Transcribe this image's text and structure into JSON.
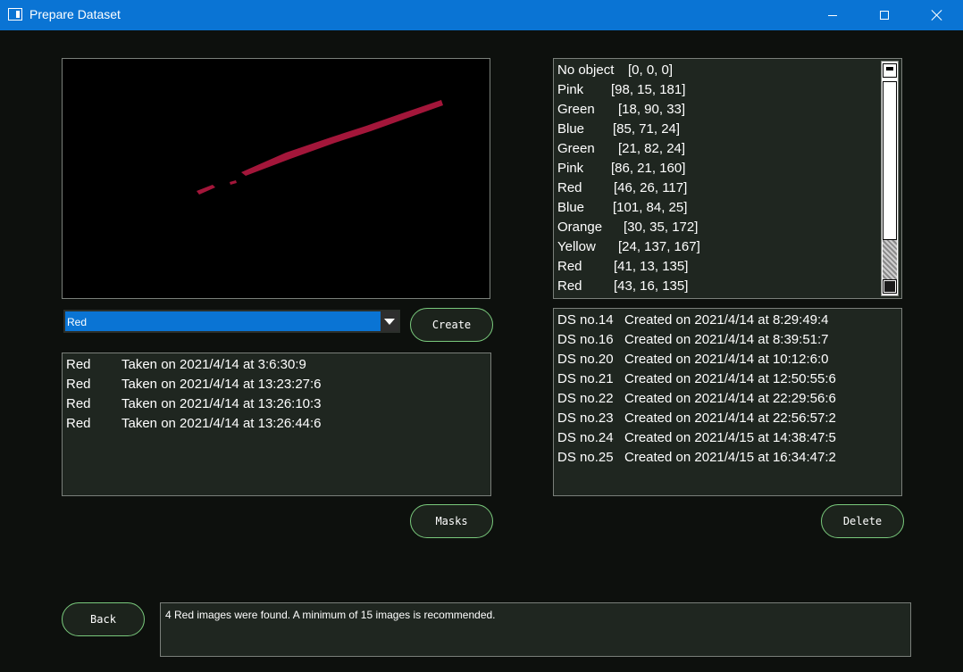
{
  "window": {
    "title": "Prepare Dataset"
  },
  "combo": {
    "selected": "Red"
  },
  "buttons": {
    "create": "Create",
    "masks": "Masks",
    "delete": "Delete",
    "back": "Back"
  },
  "images_list": [
    {
      "color": "Red",
      "info": "Taken on 2021/4/14 at 3:6:30:9"
    },
    {
      "color": "Red",
      "info": "Taken on 2021/4/14 at 13:23:27:6"
    },
    {
      "color": "Red",
      "info": "Taken on 2021/4/14 at 13:26:10:3"
    },
    {
      "color": "Red",
      "info": "Taken on 2021/4/14 at 13:26:44:6"
    }
  ],
  "objects_list": [
    {
      "name": "No object",
      "value": "[0, 0, 0]"
    },
    {
      "name": "Pink",
      "value": "[98, 15, 181]"
    },
    {
      "name": "Green",
      "value": "[18, 90, 33]"
    },
    {
      "name": "Blue",
      "value": "[85, 71, 24]"
    },
    {
      "name": "Green",
      "value": "[21, 82, 24]"
    },
    {
      "name": "Pink",
      "value": "[86, 21, 160]"
    },
    {
      "name": "Red",
      "value": "[46, 26, 117]"
    },
    {
      "name": "Blue",
      "value": "[101, 84, 25]"
    },
    {
      "name": "Orange",
      "value": "[30, 35, 172]"
    },
    {
      "name": "Yellow",
      "value": "[24, 137, 167]"
    },
    {
      "name": "Red",
      "value": "[41, 13, 135]"
    },
    {
      "name": "Red",
      "value": "[43, 16, 135]"
    }
  ],
  "datasets_list": [
    {
      "name": "DS no.14",
      "info": "Created on 2021/4/14 at 8:29:49:4"
    },
    {
      "name": "DS no.16",
      "info": "Created on 2021/4/14 at 8:39:51:7"
    },
    {
      "name": "DS no.20",
      "info": "Created on 2021/4/14 at 10:12:6:0"
    },
    {
      "name": "DS no.21",
      "info": "Created on 2021/4/14 at 12:50:55:6"
    },
    {
      "name": "DS no.22",
      "info": "Created on 2021/4/14 at 22:29:56:6"
    },
    {
      "name": "DS no.23",
      "info": "Created on 2021/4/14 at 22:56:57:2"
    },
    {
      "name": "DS no.24",
      "info": "Created on 2021/4/15 at 14:38:47:5"
    },
    {
      "name": "DS no.25",
      "info": "Created on 2021/4/15 at 16:34:47:2"
    }
  ],
  "status": {
    "message": "4 Red images were found. A minimum of 15 images is recommended."
  },
  "colors": {
    "titlebar": "#0a74d4",
    "background": "#0d100d",
    "panel": "#1f2620",
    "button_border": "#79c97c",
    "object_stroke": "#a3163a"
  },
  "icons": {
    "app": "app-window-icon",
    "minimize": "minimize-icon",
    "maximize": "maximize-icon",
    "close": "close-icon",
    "dropdown": "chevron-down-icon"
  }
}
